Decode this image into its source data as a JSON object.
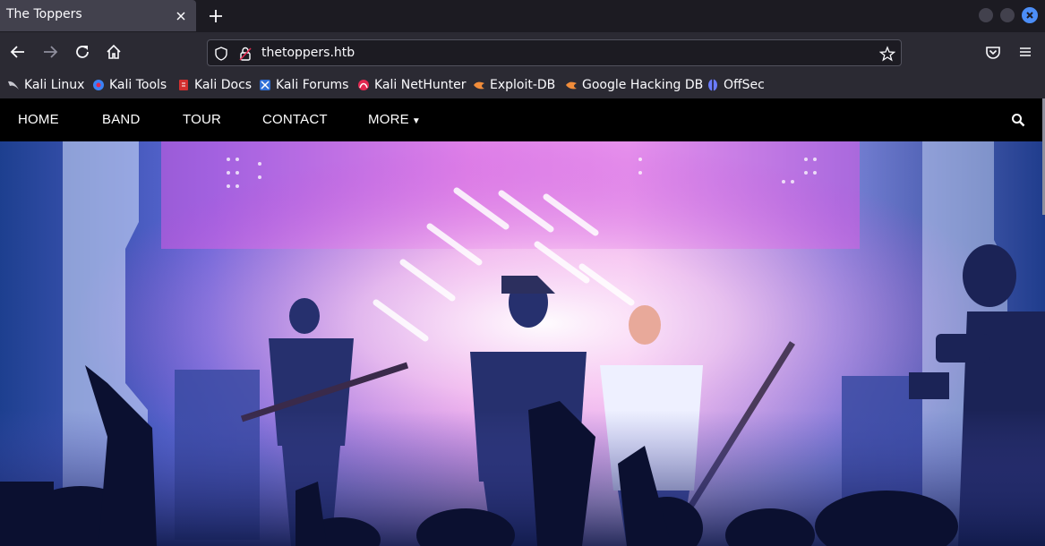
{
  "browser": {
    "tab": {
      "title": "The Toppers"
    },
    "url": "thetoppers.htb",
    "bookmarks": [
      {
        "label": "Kali Linux",
        "icon": "kali-dragon-icon"
      },
      {
        "label": "Kali Tools",
        "icon": "kali-tools-icon"
      },
      {
        "label": "Kali Docs",
        "icon": "kali-docs-icon"
      },
      {
        "label": "Kali Forums",
        "icon": "kali-forums-icon"
      },
      {
        "label": "Kali NetHunter",
        "icon": "nethunter-icon"
      },
      {
        "label": "Exploit-DB",
        "icon": "exploit-db-icon"
      },
      {
        "label": "Google Hacking DB",
        "icon": "ghdb-icon"
      },
      {
        "label": "OffSec",
        "icon": "offsec-icon"
      }
    ]
  },
  "site": {
    "nav": {
      "items": [
        "HOME",
        "BAND",
        "TOUR",
        "CONTACT",
        "MORE"
      ]
    }
  },
  "colors": {
    "chrome_bg": "#1c1b22",
    "toolbar_bg": "#2b2a33",
    "accent": "#4c8ef7"
  }
}
